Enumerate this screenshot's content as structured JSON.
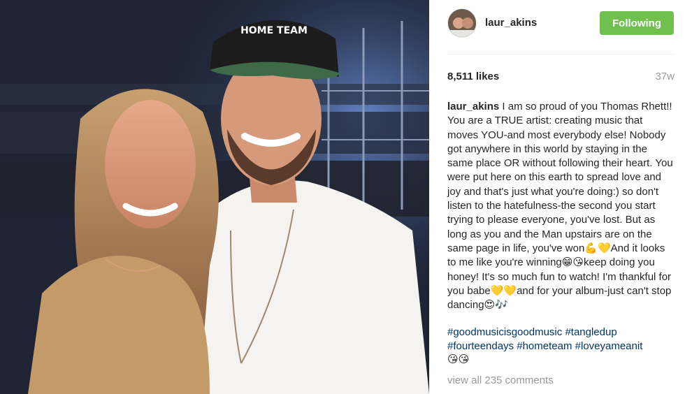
{
  "post": {
    "username": "laur_akins",
    "follow_button": "Following",
    "likes": "8,511 likes",
    "time_ago": "37w",
    "caption_user": "laur_akins",
    "caption_text": " I am so proud of you Thomas Rhett!! You are a TRUE artist: creating music that moves YOU-and most everybody else! Nobody got anywhere in this world by staying in the same place OR without following their heart. You were put here on this earth to spread love and joy and that's just what you're doing:) so don't listen to the hatefulness-the second you start trying to please everyone, you've lost. But as long as you and the Man upstairs are on the same page in life, you've won💪💛And it looks to me like you're winning😁😘keep doing you honey! It's so much fun to watch! I'm thankful for you babe💛💛and for your album-just can't stop dancing😍🎶",
    "hashtags_line1": [
      "#goodmusicisgoodmusic",
      "#tangledup"
    ],
    "hashtags_line2": [
      "#fourteendays",
      "#hometeam",
      "#loveyameanit"
    ],
    "trailing_emoji": "😘😘",
    "view_comments": "view all 235 comments"
  },
  "photo": {
    "hat_text": "HOME TEAM"
  },
  "colors": {
    "follow_green": "#70c050",
    "hashtag_blue": "#003569",
    "muted_gray": "#999999"
  }
}
